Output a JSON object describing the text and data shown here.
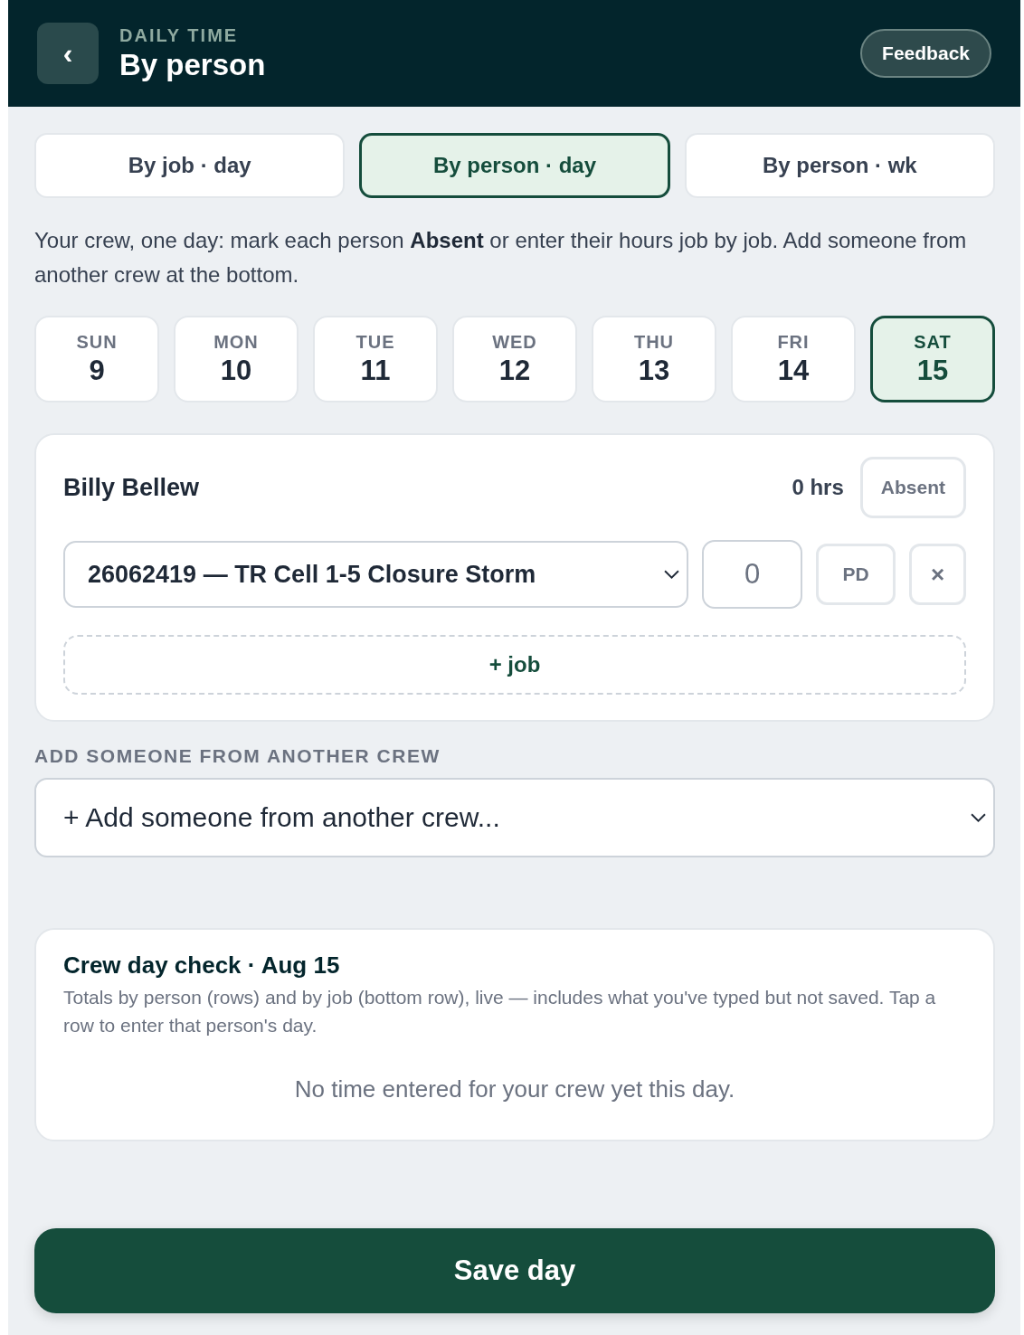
{
  "header": {
    "back_icon": "‹",
    "eyebrow": "DAILY TIME",
    "title": "By person",
    "feedback_button": "Feedback"
  },
  "view_tabs": [
    {
      "label": "By job · day",
      "selected": false
    },
    {
      "label": "By person · day",
      "selected": true
    },
    {
      "label": "By person · wk",
      "selected": false
    }
  ],
  "description": "Your crew, one day: mark each person **Absent** or enter their hours job by job. Add someone from another crew at the bottom.",
  "days": [
    {
      "weekday": "SUN",
      "date": "9",
      "selected": false
    },
    {
      "weekday": "MON",
      "date": "10",
      "selected": false
    },
    {
      "weekday": "TUE",
      "date": "11",
      "selected": false
    },
    {
      "weekday": "WED",
      "date": "12",
      "selected": false
    },
    {
      "weekday": "THU",
      "date": "13",
      "selected": false
    },
    {
      "weekday": "FRI",
      "date": "14",
      "selected": false
    },
    {
      "weekday": "SAT",
      "date": "15",
      "selected": true
    }
  ],
  "people": [
    {
      "name": "Billy Bellew",
      "total": "0 hrs",
      "absent_button": "Absent",
      "absent": false,
      "jobs": [
        {
          "job": "26062419 — TR Cell 1-5 Closure Storm",
          "hours": "0",
          "pd_button": "PD",
          "remove_button": "×"
        }
      ],
      "add_job_button": "+ job"
    }
  ],
  "another_crew": {
    "label": "ADD SOMEONE FROM ANOTHER CREW",
    "select": "+ Add someone from another crew..."
  },
  "check": {
    "title": "Crew day check · Aug 15",
    "subtitle": "Totals by person (rows) and by job (bottom row), live — includes what you've typed but not saved. Tap a row to enter that person's day.",
    "empty": "No time entered for your crew yet this day."
  },
  "save_button": "Save day"
}
